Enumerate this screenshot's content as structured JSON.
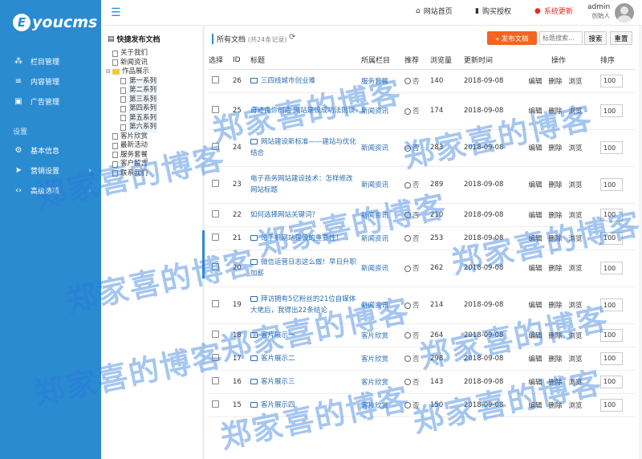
{
  "brand": {
    "logo_letter": "E",
    "logo_rest": "youcms"
  },
  "sidebar": {
    "items": [
      {
        "label": "栏目管理",
        "icon": "sitemap-icon"
      },
      {
        "label": "内容管理",
        "icon": "list-icon"
      },
      {
        "label": "广告管理",
        "icon": "image-icon"
      }
    ],
    "group_title": "设置",
    "settings": [
      {
        "label": "基本信息",
        "icon": "gear-icon"
      },
      {
        "label": "营销设置",
        "icon": "send-icon",
        "arrow": "›"
      },
      {
        "label": "高级选项",
        "icon": "code-icon",
        "arrow": "›"
      }
    ]
  },
  "header": {
    "home": "网站首页",
    "buy": "购买授权",
    "update": "系统更新",
    "user_name": "admin",
    "user_role": "创始人"
  },
  "tree": {
    "title": "快捷发布文档",
    "items": [
      {
        "label": "关于我们",
        "level": 1
      },
      {
        "label": "新闻资讯",
        "level": 1
      },
      {
        "label": "作品展示",
        "level": 0,
        "folder": true
      },
      {
        "label": "第一系列",
        "level": 2
      },
      {
        "label": "第二系列",
        "level": 2
      },
      {
        "label": "第三系列",
        "level": 2
      },
      {
        "label": "第四系列",
        "level": 2
      },
      {
        "label": "第五系列",
        "level": 2
      },
      {
        "label": "第六系列",
        "level": 2
      },
      {
        "label": "客片欣赏",
        "level": 1
      },
      {
        "label": "最新活动",
        "level": 1
      },
      {
        "label": "服务套餐",
        "level": 1
      },
      {
        "label": "客户留言",
        "level": 1
      },
      {
        "label": "联系我们",
        "level": 1
      }
    ]
  },
  "toolbar": {
    "all_docs": "所有文档",
    "count": "(共24条记录)",
    "publish": "+ 发布文档",
    "search_placeholder": "标题搜索...",
    "search": "搜索",
    "reset": "重置"
  },
  "table": {
    "headers": [
      "选择",
      "ID",
      "标题",
      "所属栏目",
      "推荐",
      "浏览量",
      "更新时间",
      "操作",
      "排序"
    ],
    "ops": [
      "编辑",
      "删除",
      "浏览"
    ],
    "rec_label": "否",
    "rows": [
      {
        "id": "26",
        "title": "三四线城市创业难",
        "img": true,
        "cat": "服务套餐",
        "views": "140",
        "date": "2018-09-08",
        "sort": "100",
        "tall": false
      },
      {
        "id": "25",
        "title": "奇迹由你创造 网站建设成功法则谈",
        "img": false,
        "cat": "新闻资讯",
        "views": "174",
        "date": "2018-09-08",
        "sort": "100",
        "tall": true
      },
      {
        "id": "24",
        "title": "网站建设新标准——建站与优化结合",
        "img": true,
        "cat": "新闻资讯",
        "views": "283",
        "date": "2018-09-08",
        "sort": "100",
        "tall": true
      },
      {
        "id": "23",
        "title": "电子商务网站建设技术：怎样修改网站标题",
        "img": false,
        "cat": "新闻资讯",
        "views": "289",
        "date": "2018-09-08",
        "sort": "100",
        "tall": true
      },
      {
        "id": "22",
        "title": "如何选择网站关键词？",
        "img": false,
        "cat": "新闻资讯",
        "views": "210",
        "date": "2018-09-08",
        "sort": "100",
        "tall": false
      },
      {
        "id": "21",
        "title": "论手机网站建设的重要性！",
        "img": true,
        "cat": "新闻资讯",
        "views": "253",
        "date": "2018-09-08",
        "sort": "100",
        "tall": false
      },
      {
        "id": "20",
        "title": "微信运营日志这么做！早日升职加薪",
        "img": true,
        "cat": "新闻资讯",
        "views": "262",
        "date": "2018-09-08",
        "sort": "100",
        "tall": true
      },
      {
        "id": "19",
        "title": "拜访拥有5亿粉丝的21位自媒体大佬后，我得出22条结论",
        "img": true,
        "cat": "新闻资讯",
        "views": "214",
        "date": "2018-09-08",
        "sort": "100",
        "tall": true
      },
      {
        "id": "18",
        "title": "客片展示一",
        "img": true,
        "cat": "客片欣赏",
        "views": "264",
        "date": "2018-09-08",
        "sort": "100",
        "tall": false
      },
      {
        "id": "17",
        "title": "客片展示二",
        "img": true,
        "cat": "客片欣赏",
        "views": "298",
        "date": "2018-09-08",
        "sort": "100",
        "tall": false
      },
      {
        "id": "16",
        "title": "客片展示三",
        "img": true,
        "cat": "客片欣赏",
        "views": "143",
        "date": "2018-09-08",
        "sort": "100",
        "tall": false
      },
      {
        "id": "15",
        "title": "客片展示四",
        "img": true,
        "cat": "客片欣赏",
        "views": "150",
        "date": "2018-09-08",
        "sort": "100",
        "tall": false
      }
    ]
  },
  "watermark": "郑家喜的博客"
}
